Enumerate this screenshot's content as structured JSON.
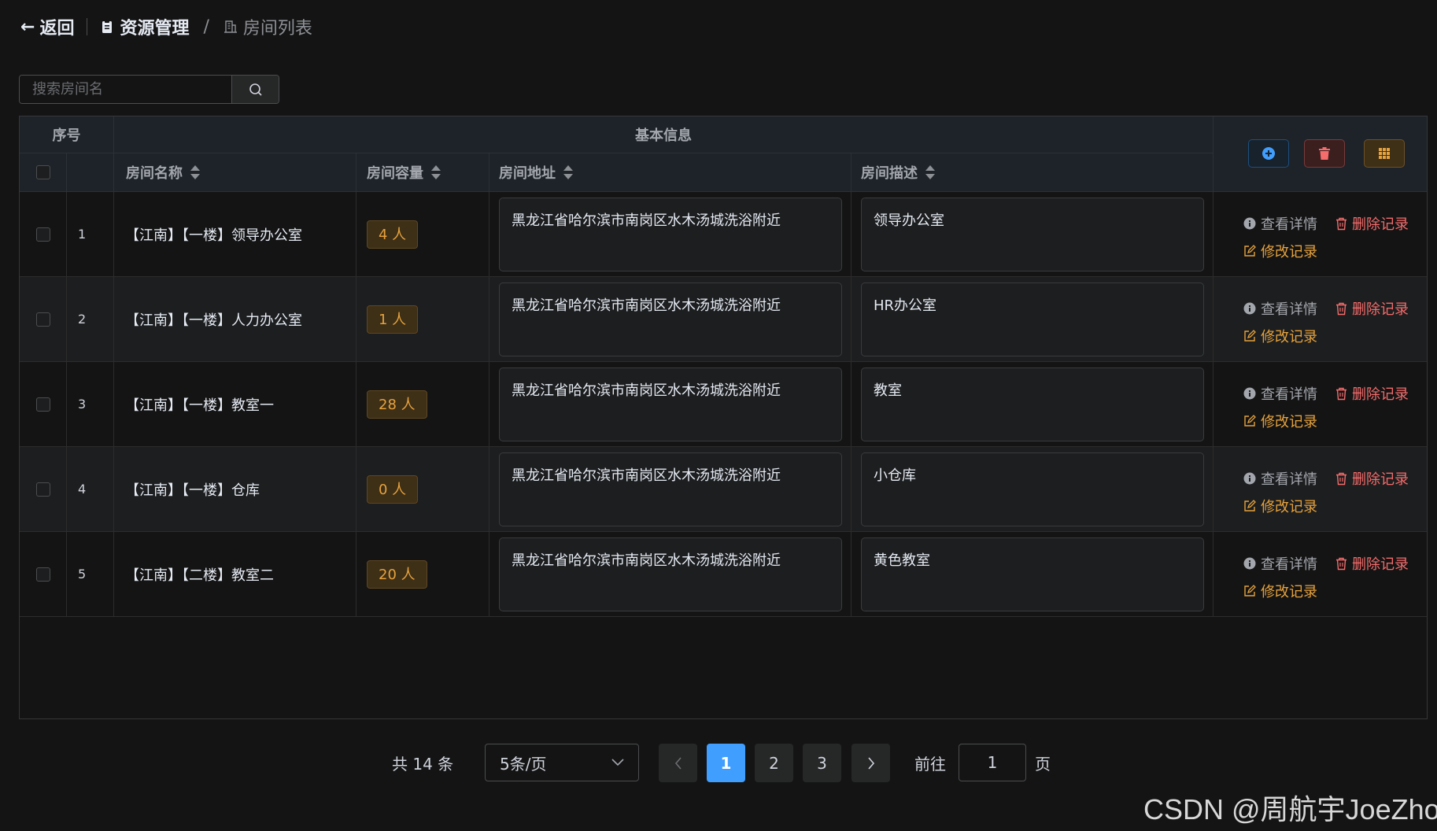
{
  "header": {
    "back_label": "返回",
    "breadcrumb": [
      "资源管理",
      "房间列表"
    ],
    "separator": "/"
  },
  "search": {
    "placeholder": "搜索房间名",
    "icon": "search-icon"
  },
  "table": {
    "group_headers": {
      "index": "序号",
      "basic_info": "基本信息"
    },
    "columns": {
      "name": "房间名称",
      "capacity": "房间容量",
      "address": "房间地址",
      "description": "房间描述"
    },
    "toolbar": [
      {
        "icon": "add-circle-icon",
        "color": "#409eff"
      },
      {
        "icon": "trash-icon",
        "color": "#f56c6c"
      },
      {
        "icon": "grid-icon",
        "color": "#e6a23c"
      }
    ],
    "rows": [
      {
        "index": "1",
        "name": "【江南】【一楼】领导办公室",
        "capacity": "4 人",
        "address": "黑龙江省哈尔滨市南岗区水木汤城洗浴附近",
        "description": "领导办公室"
      },
      {
        "index": "2",
        "name": "【江南】【一楼】人力办公室",
        "capacity": "1 人",
        "address": "黑龙江省哈尔滨市南岗区水木汤城洗浴附近",
        "description": "HR办公室"
      },
      {
        "index": "3",
        "name": "【江南】【一楼】教室一",
        "capacity": "28 人",
        "address": "黑龙江省哈尔滨市南岗区水木汤城洗浴附近",
        "description": "教室"
      },
      {
        "index": "4",
        "name": "【江南】【一楼】仓库",
        "capacity": "0 人",
        "address": "黑龙江省哈尔滨市南岗区水木汤城洗浴附近",
        "description": "小仓库"
      },
      {
        "index": "5",
        "name": "【江南】【二楼】教室二",
        "capacity": "20 人",
        "address": "黑龙江省哈尔滨市南岗区水木汤城洗浴附近",
        "description": "黄色教室"
      }
    ],
    "actions": {
      "view": "查看详情",
      "delete": "删除记录",
      "edit": "修改记录"
    }
  },
  "pagination": {
    "total_label": "共 14 条",
    "page_size": "5条/页",
    "pages": [
      "1",
      "2",
      "3"
    ],
    "current_page": "1",
    "goto_label": "前往",
    "goto_value": "1",
    "page_suffix": "页"
  },
  "watermark": "CSDN @周航宇JoeZhou",
  "colors": {
    "primary": "#409eff",
    "danger": "#f56c6c",
    "warning": "#e6a23c"
  }
}
